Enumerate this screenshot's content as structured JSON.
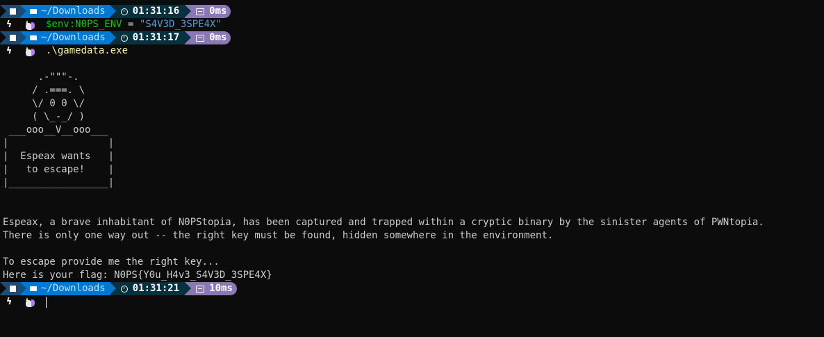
{
  "prompts": [
    {
      "path": "~/Downloads",
      "time": "01:31:16",
      "duration": "0ms"
    },
    {
      "path": "~/Downloads",
      "time": "01:31:17",
      "duration": "0ms"
    },
    {
      "path": "~/Downloads",
      "time": "01:31:21",
      "duration": "10ms"
    }
  ],
  "commands": {
    "set_env": {
      "variable": "$env:N0PS_ENV",
      "operator": "=",
      "value": "\"S4V3D_3SPE4X\""
    },
    "run_exe": ".\\gamedata.exe"
  },
  "ascii_art": [
    "      .-\"\"\"-.",
    "     / .===. \\",
    "     \\/ 0 0 \\/",
    "     ( \\_-_/ )",
    " ___ooo__V__ooo___",
    "|                 |",
    "|  Espeax wants   |",
    "|   to escape!    |",
    "|_________________|"
  ],
  "output": {
    "story_line_1": "Espeax, a brave inhabitant of N0PStopia, has been captured and trapped within a cryptic binary by the sinister agents of PWNtopia.",
    "story_line_2": "There is only one way out -- the right key must be found, hidden somewhere in the environment.",
    "escape_prompt": "To escape provide me the right key...",
    "flag_line": "Here is your flag: N0PS{Y0u_H4v3_S4V3D_3SPE4X}"
  },
  "icons": {
    "os": "windows-icon",
    "folder": "folder-icon",
    "clock": "clock-icon",
    "duration": "duration-icon",
    "prompt_symbol": "bolt-icon",
    "prompt_mascot": "unicorn-icon"
  },
  "colors": {
    "background": "#0c0c0c",
    "os_segment": "#1c4b75",
    "path_segment": "#0078d4",
    "time_segment": "#06313f",
    "duration_segment": "#8a77b5",
    "variable": "#16c60c",
    "string": "#5a9bd6",
    "executable": "#f9f1a5"
  }
}
